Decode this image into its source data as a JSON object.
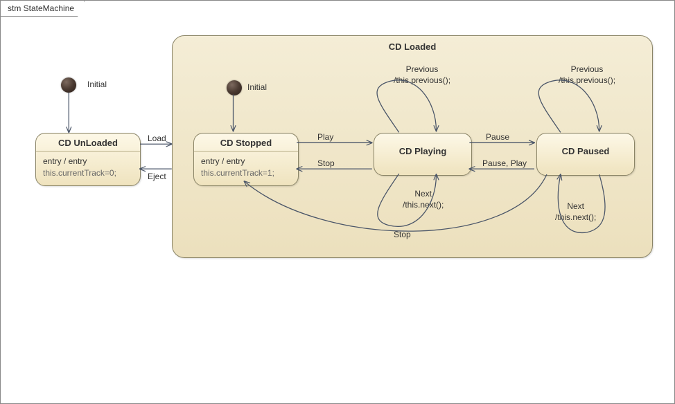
{
  "frame": {
    "title": "stm StateMachine"
  },
  "outer_initial": {
    "label": "Initial"
  },
  "unloaded": {
    "title": "CD UnLoaded",
    "entry_label": "entry / entry",
    "entry_code": "this.currentTrack=0;"
  },
  "composite": {
    "title": "CD Loaded"
  },
  "inner_initial": {
    "label": "Initial"
  },
  "stopped": {
    "title": "CD Stopped",
    "entry_label": "entry / entry",
    "entry_code": "this.currentTrack=1;"
  },
  "playing": {
    "title": "CD Playing"
  },
  "paused": {
    "title": "CD Paused"
  },
  "transitions": {
    "load": "Load",
    "eject": "Eject",
    "play": "Play",
    "stop": "Stop",
    "pause": "Pause",
    "pause_play": "Pause, Play",
    "stop_paused": "Stop",
    "prev_playing": "Previous\n/this.previous();",
    "next_playing": "Next\n/this.next();",
    "prev_paused": "Previous\n/this.previous();",
    "next_paused": "Next\n/this.next();"
  }
}
